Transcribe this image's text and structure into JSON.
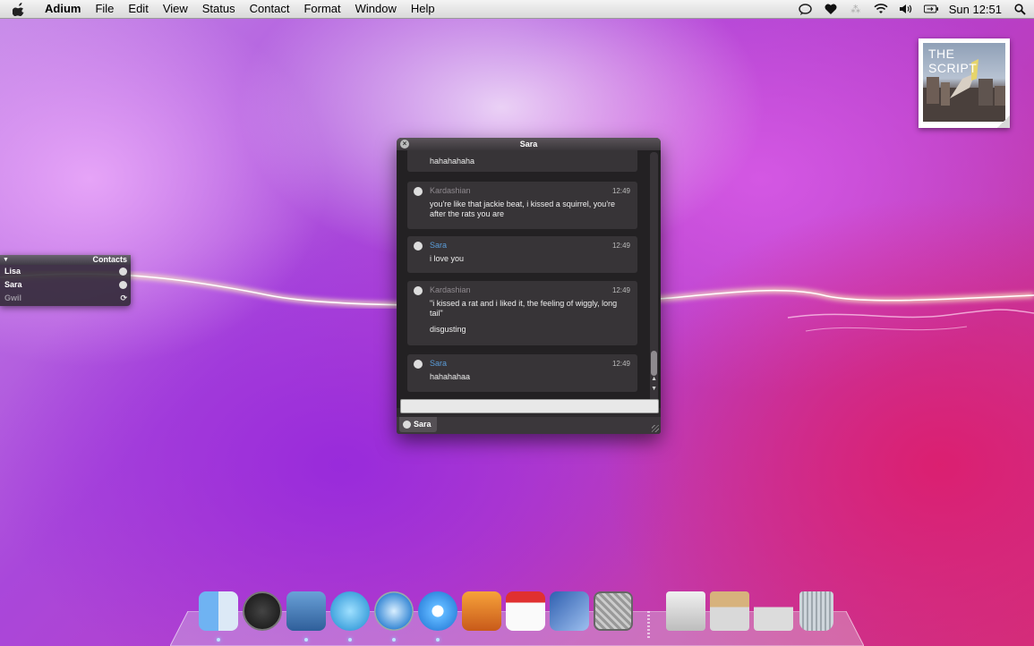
{
  "menubar": {
    "app_name": "Adium",
    "menus": [
      "File",
      "Edit",
      "View",
      "Status",
      "Contact",
      "Format",
      "Window",
      "Help"
    ],
    "clock": "Sun 12:51"
  },
  "album": {
    "title": "THE SCRIPT"
  },
  "contacts": {
    "title": "Contacts",
    "items": [
      {
        "name": "Lisa",
        "status": "available"
      },
      {
        "name": "Sara",
        "status": "available"
      },
      {
        "name": "Gwil",
        "status": "idle"
      }
    ]
  },
  "chat": {
    "title": "Sara",
    "tab_label": "Sara",
    "messages": [
      {
        "sender": "",
        "time": "",
        "lines": [
          "hahahahaha"
        ]
      },
      {
        "sender": "Kardashian",
        "time": "12:49",
        "lines": [
          "you're like that jackie beat, i kissed a squirrel, you're after the rats you are"
        ]
      },
      {
        "sender": "Sara",
        "time": "12:49",
        "lines": [
          "i love you"
        ]
      },
      {
        "sender": "Kardashian",
        "time": "12:49",
        "lines": [
          "\"i kissed a rat and i liked it, the feeling of wiggly, long tail\"",
          "disgusting"
        ]
      },
      {
        "sender": "Sara",
        "time": "12:49",
        "lines": [
          "hahahahaa"
        ]
      }
    ]
  },
  "dock": {
    "apps": [
      "finder",
      "dashboard",
      "mail",
      "adium",
      "safari",
      "itunes",
      "iphoto",
      "ical",
      "word",
      "system-preferences"
    ],
    "folders": [
      "documents-stack",
      "applications-stack",
      "downloads-stack"
    ],
    "trash": "trash"
  },
  "colors": {
    "self_sender": "#5a9cd8",
    "other_sender": "#8f8a8f"
  }
}
